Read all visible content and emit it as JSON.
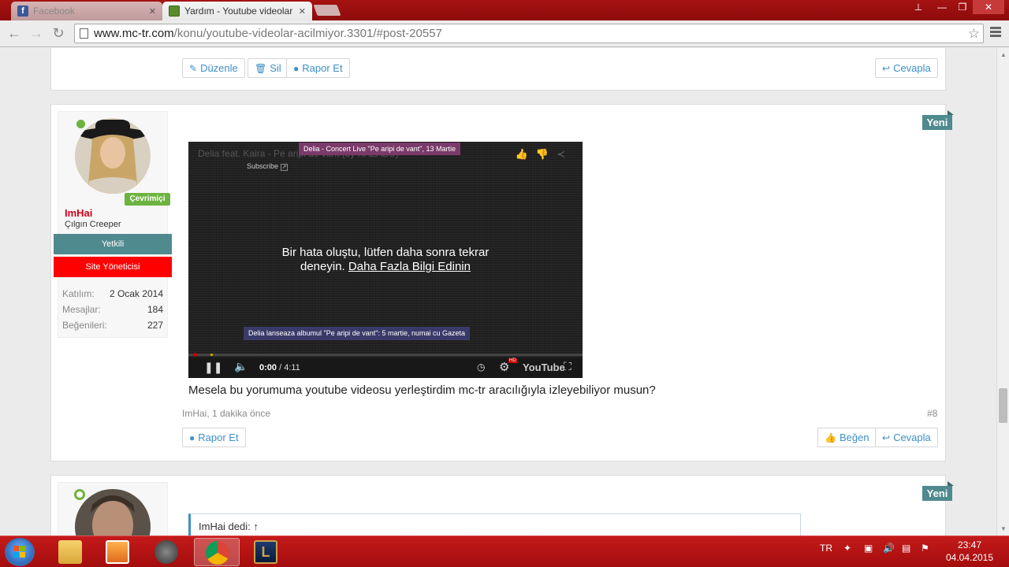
{
  "browser": {
    "tabs": [
      {
        "title": "Facebook",
        "active": false
      },
      {
        "title": "Yardım - Youtube videolar",
        "active": true
      }
    ],
    "url_host": "www.mc-tr.com",
    "url_path": "/konu/youtube-videolar-acilmiyor.3301/#post-20557"
  },
  "prev_post": {
    "buttons": {
      "edit": "Düzenle",
      "delete": "Sil",
      "report": "Rapor Et",
      "reply": "Cevapla"
    }
  },
  "post": {
    "new_badge": "Yeni",
    "user": {
      "online_badge": "Çevrimiçi",
      "name": "ImHai",
      "title": "Çılgın Creeper",
      "banner_staff": "Yetkili",
      "banner_admin": "Site Yöneticisi",
      "stats": [
        {
          "label": "Katılım:",
          "value": "2 Ocak 2014"
        },
        {
          "label": "Mesajlar:",
          "value": "184"
        },
        {
          "label": "Beğenileri:",
          "value": "227"
        }
      ]
    },
    "video": {
      "title": "Delia feat. Kaira - Pe aripi de vant (by KAZABU)",
      "subscribe": "Subscribe",
      "top_annotation": "Delia - Concert Live \"Pe aripi de vant\", 13 Martie",
      "error_line1": "Bir hata oluştu, lütfen daha sonra tekrar",
      "error_line2_prefix": "deneyin.",
      "error_link": "Daha Fazla Bilgi Edinin",
      "bottom_annotation": "Delia lanseaza albumul \"Pe aripi de vant\": 5 martie, numai cu Gazeta",
      "time_current": "0:00",
      "time_total": "/ 4:11",
      "hd": "HD",
      "youtube_logo": "YouTube"
    },
    "message": "Mesela bu yorumuma youtube videosu yerleştirdim mc-tr aracılığıyla izleyebiliyor musun?",
    "meta": "ImHai, 1 dakika önce",
    "number": "#8",
    "buttons": {
      "report": "Rapor Et",
      "like": "Beğen",
      "reply": "Cevapla"
    }
  },
  "next_post": {
    "new_badge": "Yeni",
    "quote_text": "ImHai dedi: ↑"
  },
  "taskbar": {
    "language": "TR",
    "time": "23:47",
    "date": "04.04.2015"
  },
  "colors": {
    "accent": "#3d8fc6",
    "teal": "#4f8a8e",
    "online_green": "#6db33f",
    "admin_red": "#ff0000",
    "chrome_red": "#a51212"
  }
}
